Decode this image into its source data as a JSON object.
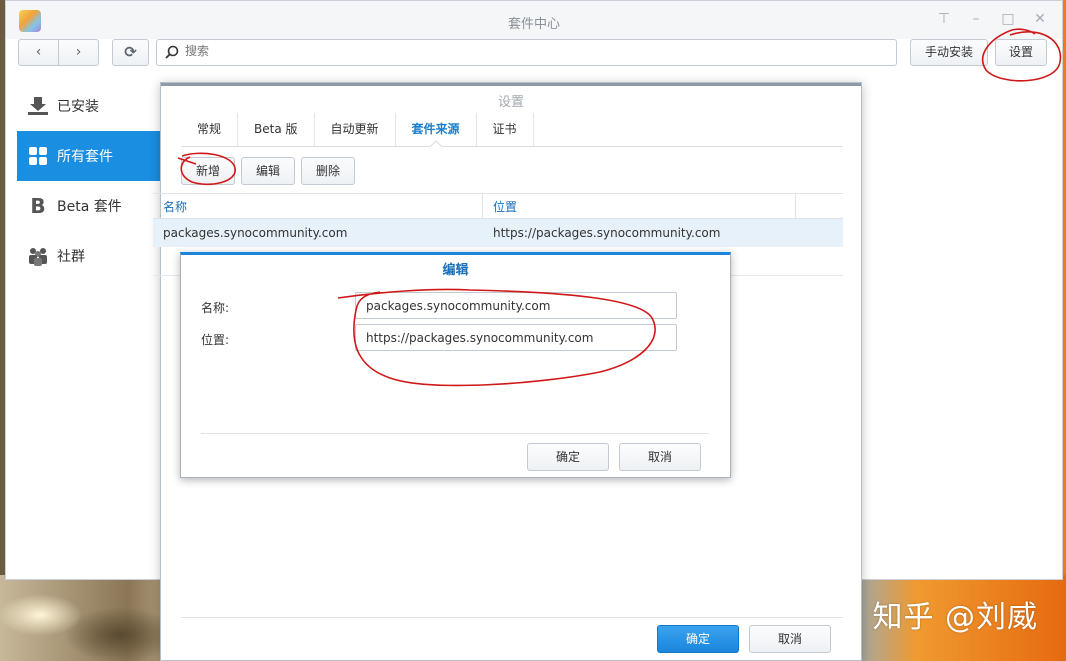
{
  "window": {
    "title": "套件中心",
    "controls": [
      "pin-icon",
      "minimize-icon",
      "maximize-icon",
      "close-icon"
    ]
  },
  "toolbar": {
    "back_icon": "‹",
    "forward_icon": "›",
    "refresh_icon": "⟳",
    "search_placeholder": "搜索",
    "manual_install_label": "手动安装",
    "settings_label": "设置"
  },
  "sidebar": {
    "items": [
      {
        "label": "已安装",
        "icon": "download-icon"
      },
      {
        "label": "所有套件",
        "icon": "grid-icon"
      },
      {
        "label": "Beta 套件",
        "icon": "beta-icon"
      },
      {
        "label": "社群",
        "icon": "community-icon"
      }
    ]
  },
  "settings_dialog": {
    "title": "设置",
    "tabs": [
      "常规",
      "Beta 版",
      "自动更新",
      "套件来源",
      "证书"
    ],
    "active_tab": "套件来源",
    "actions": {
      "add": "新增",
      "edit": "编辑",
      "delete": "删除"
    },
    "columns": {
      "name": "名称",
      "location": "位置"
    },
    "rows": [
      {
        "name": "packages.synocommunity.com",
        "location": "https://packages.synocommunity.com"
      }
    ],
    "ok_label": "确定",
    "cancel_label": "取消"
  },
  "edit_dialog": {
    "title": "编辑",
    "name_label": "名称:",
    "name_value": "packages.synocommunity.com",
    "location_label": "位置:",
    "location_value": "https://packages.synocommunity.com",
    "ok_label": "确定",
    "cancel_label": "取消"
  },
  "watermark": "知乎 @刘威",
  "colors": {
    "accent": "#1a8ee0",
    "annotation": "#d01818"
  }
}
